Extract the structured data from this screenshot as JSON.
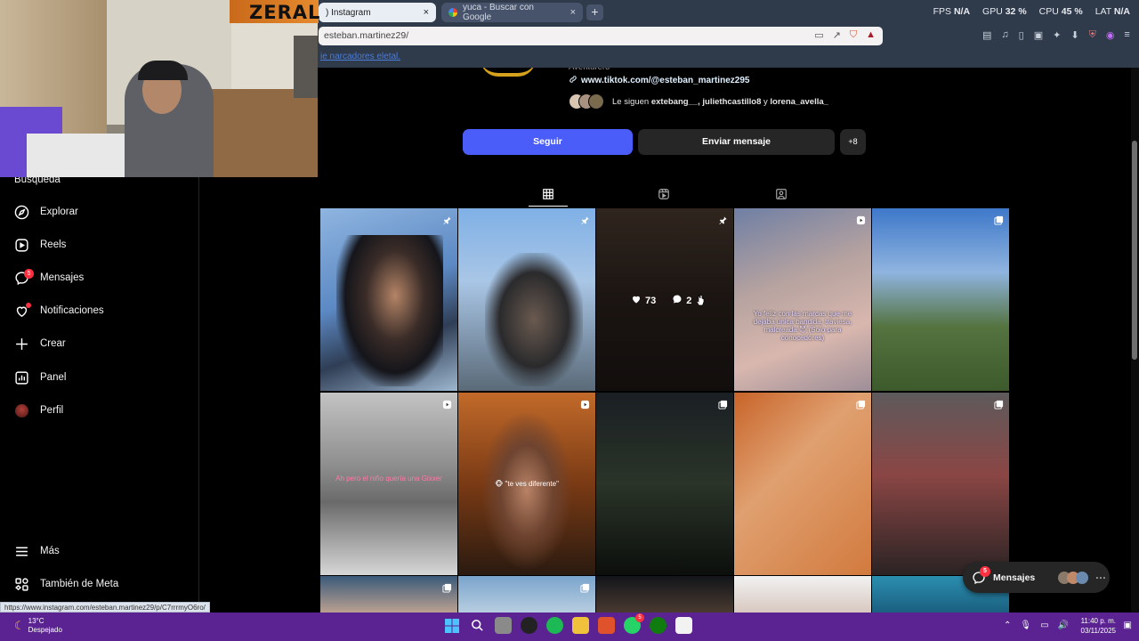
{
  "browser": {
    "tabs": [
      {
        "title": ") Instagram",
        "close": "×"
      },
      {
        "title": "yuca - Buscar con Google",
        "close": "×"
      }
    ],
    "new_tab": "+",
    "url": "esteban.martinez29/",
    "bookmark_link": "ie narcadores eletal.",
    "stats": {
      "fps_label": "FPS",
      "fps_value": "N/A",
      "gpu_label": "GPU",
      "gpu_value": "32 %",
      "cpu_label": "CPU",
      "cpu_value": "45 %",
      "lat_label": "LAT",
      "lat_value": "N/A"
    },
    "status_url": "https://www.instagram.com/esteban.martinez29/p/C7rrrmyO6ro/"
  },
  "webcam": {
    "brand": "ZERAL"
  },
  "sidebar": {
    "partial_item": "Búsqueda",
    "items": [
      {
        "label": "Explorar",
        "icon": "compass-icon"
      },
      {
        "label": "Reels",
        "icon": "reels-icon"
      },
      {
        "label": "Mensajes",
        "icon": "messenger-icon",
        "badge": "5"
      },
      {
        "label": "Notificaciones",
        "icon": "heart-icon"
      },
      {
        "label": "Crear",
        "icon": "plus-icon"
      },
      {
        "label": "Panel",
        "icon": "dashboard-icon"
      },
      {
        "label": "Perfil",
        "icon": "avatar"
      }
    ],
    "more": "Más",
    "meta": "También de Meta"
  },
  "profile": {
    "bio": "Aventurero",
    "link": "www.tiktok.com/@esteban_martinez295",
    "followed_by_prefix": "Le siguen",
    "followed_by_names": "extebang__, juliethcastillo8",
    "followed_by_and": "y",
    "followed_by_last": "lorena_avella_",
    "follow_button": "Seguir",
    "message_button": "Enviar mensaje",
    "add_icon": "+8"
  },
  "posts": [
    {
      "caption": "",
      "icon": "pin-icon"
    },
    {
      "caption": "",
      "icon": "pin-icon"
    },
    {
      "caption": "",
      "icon": "pin-icon",
      "likes": "73",
      "comments": "2"
    },
    {
      "caption": "Yo feliz con las marcas que me dejaba única bandida, traviesa, malcreada 😈 (Solo para conocedores)",
      "icon": "reel-icon"
    },
    {
      "caption": "",
      "icon": "carousel-icon"
    },
    {
      "caption": "Ah pero el niño quería una Gixxer",
      "icon": "reel-icon"
    },
    {
      "caption": "🐵 \"te ves diferente\"",
      "icon": "reel-icon"
    },
    {
      "caption": "",
      "icon": "carousel-icon"
    },
    {
      "caption": "",
      "icon": "carousel-icon"
    },
    {
      "caption": "",
      "icon": "carousel-icon"
    },
    {
      "caption": "",
      "icon": "carousel-icon"
    },
    {
      "caption": "",
      "icon": "carousel-icon"
    }
  ],
  "floating_messages": {
    "label": "Mensajes",
    "badge": "5"
  },
  "taskbar": {
    "temp": "13°C",
    "weather": "Despejado",
    "time": "11:40 p. m.",
    "date": "03/11/2025",
    "whatsapp_badge": "5"
  }
}
